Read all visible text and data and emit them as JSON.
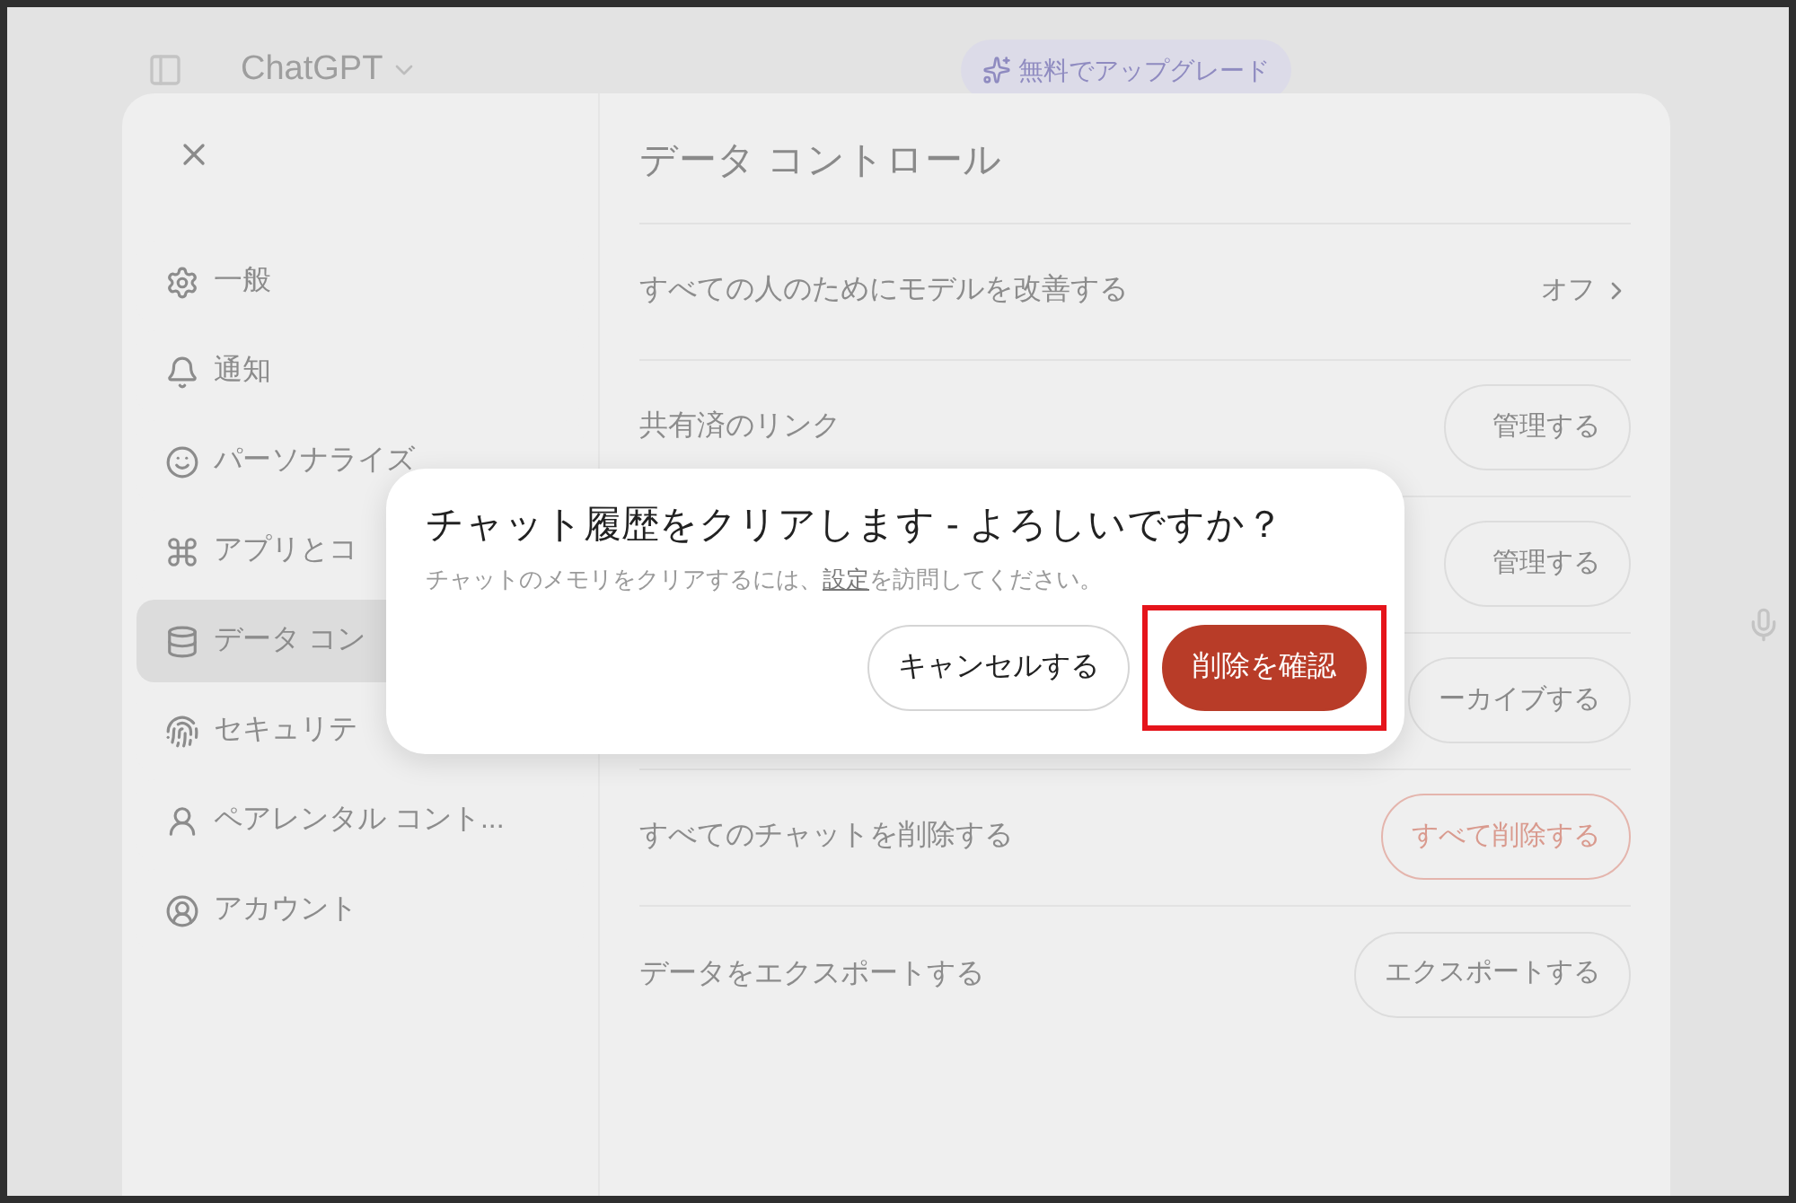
{
  "top_bar": {
    "title": "ChatGPT",
    "upgrade": "無料でアップグレード"
  },
  "settings": {
    "sidebar": [
      {
        "label": "一般",
        "selected": false
      },
      {
        "label": "通知",
        "selected": false
      },
      {
        "label": "パーソナライズ",
        "selected": false
      },
      {
        "label": "アプリとコ",
        "selected": false
      },
      {
        "label": "データ コン",
        "selected": true
      },
      {
        "label": "セキュリテ",
        "selected": false
      },
      {
        "label": "ペアレンタル コント...",
        "selected": false
      },
      {
        "label": "アカウント",
        "selected": false
      }
    ],
    "title": "データ コントロール",
    "rows": [
      {
        "label": "すべての人のためにモデルを改善する",
        "kind": "value",
        "value": "オフ"
      },
      {
        "label": "共有済のリンク",
        "kind": "button",
        "value": "管理する"
      },
      {
        "kind": "button",
        "value": "管理する"
      },
      {
        "kind": "button",
        "value": "ーカイブする"
      },
      {
        "label": "すべてのチャットを削除する",
        "kind": "danger",
        "value": "すべて削除する"
      },
      {
        "label": "データをエクスポートする",
        "kind": "button",
        "value": "エクスポートする"
      }
    ]
  },
  "dialog": {
    "title": "チャット履歴をクリアします - よろしいですか？",
    "message_before": "チャットのメモリをクリアするには、",
    "link": "設定",
    "message_after": "を訪問してください。",
    "buttons": [
      {
        "label": "キャンセルする",
        "kind": "secondary",
        "highlighted": false
      },
      {
        "label": "削除を確認",
        "kind": "danger",
        "highlighted": true
      }
    ]
  }
}
